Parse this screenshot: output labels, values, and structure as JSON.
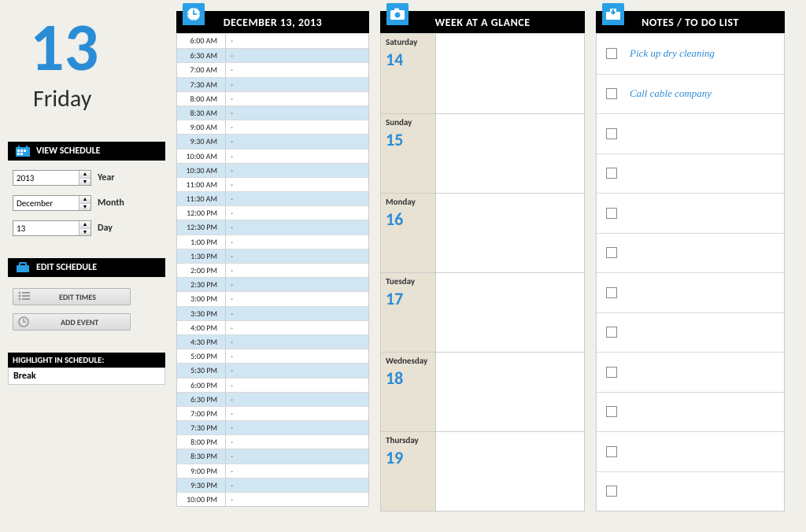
{
  "date": {
    "big_number": "13",
    "day_name": "Friday",
    "full_date": "DECEMBER 13, 2013"
  },
  "controls": {
    "view_schedule_label": "VIEW SCHEDULE",
    "year": {
      "value": "2013",
      "label": "Year"
    },
    "month": {
      "value": "December",
      "label": "Month"
    },
    "day": {
      "value": "13",
      "label": "Day"
    },
    "edit_schedule_label": "EDIT SCHEDULE",
    "edit_times_btn": "EDIT TIMES",
    "add_event_btn": "ADD EVENT",
    "highlight_header": "HIGHLIGHT IN SCHEDULE:",
    "highlight_value": "Break"
  },
  "schedule": {
    "slots": [
      {
        "t": "6:00 AM",
        "v": "-"
      },
      {
        "t": "6:30 AM",
        "v": "-"
      },
      {
        "t": "7:00 AM",
        "v": "-"
      },
      {
        "t": "7:30 AM",
        "v": "-"
      },
      {
        "t": "8:00 AM",
        "v": "-"
      },
      {
        "t": "8:30 AM",
        "v": "-"
      },
      {
        "t": "9:00 AM",
        "v": "-"
      },
      {
        "t": "9:30 AM",
        "v": "-"
      },
      {
        "t": "10:00 AM",
        "v": "-"
      },
      {
        "t": "10:30 AM",
        "v": "-"
      },
      {
        "t": "11:00 AM",
        "v": "-"
      },
      {
        "t": "11:30 AM",
        "v": "-"
      },
      {
        "t": "12:00 PM",
        "v": "-"
      },
      {
        "t": "12:30 PM",
        "v": "-"
      },
      {
        "t": "1:00 PM",
        "v": "-"
      },
      {
        "t": "1:30 PM",
        "v": "-"
      },
      {
        "t": "2:00 PM",
        "v": "-"
      },
      {
        "t": "2:30 PM",
        "v": "-"
      },
      {
        "t": "3:00 PM",
        "v": "-"
      },
      {
        "t": "3:30 PM",
        "v": "-"
      },
      {
        "t": "4:00 PM",
        "v": "-"
      },
      {
        "t": "4:30 PM",
        "v": "-"
      },
      {
        "t": "5:00 PM",
        "v": "-"
      },
      {
        "t": "5:30 PM",
        "v": "-"
      },
      {
        "t": "6:00 PM",
        "v": "-"
      },
      {
        "t": "6:30 PM",
        "v": "-"
      },
      {
        "t": "7:00 PM",
        "v": "-"
      },
      {
        "t": "7:30 PM",
        "v": "-"
      },
      {
        "t": "8:00 PM",
        "v": "-"
      },
      {
        "t": "8:30 PM",
        "v": "-"
      },
      {
        "t": "9:00 PM",
        "v": "-"
      },
      {
        "t": "9:30 PM",
        "v": "-"
      },
      {
        "t": "10:00 PM",
        "v": "-"
      }
    ]
  },
  "week": {
    "title": "WEEK AT A GLANCE",
    "days": [
      {
        "name": "Saturday",
        "num": "14"
      },
      {
        "name": "Sunday",
        "num": "15"
      },
      {
        "name": "Monday",
        "num": "16"
      },
      {
        "name": "Tuesday",
        "num": "17"
      },
      {
        "name": "Wednesday",
        "num": "18"
      },
      {
        "name": "Thursday",
        "num": "19"
      }
    ]
  },
  "notes": {
    "title": "NOTES / TO DO LIST",
    "items": [
      {
        "done": false,
        "text": "Pick up dry cleaning"
      },
      {
        "done": false,
        "text": "Call cable company"
      },
      {
        "done": false,
        "text": ""
      },
      {
        "done": false,
        "text": ""
      },
      {
        "done": false,
        "text": ""
      },
      {
        "done": false,
        "text": ""
      },
      {
        "done": false,
        "text": ""
      },
      {
        "done": false,
        "text": ""
      },
      {
        "done": false,
        "text": ""
      },
      {
        "done": false,
        "text": ""
      },
      {
        "done": false,
        "text": ""
      },
      {
        "done": false,
        "text": ""
      }
    ]
  }
}
